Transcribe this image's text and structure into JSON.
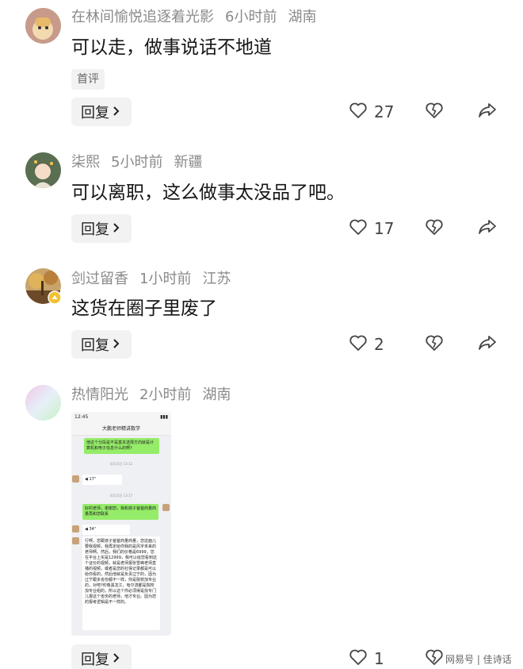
{
  "comments": [
    {
      "username": "在林间愉悦追逐着光影",
      "time": "6小时前",
      "location": "湖南",
      "text": "可以走，做事说话不地道",
      "tag": "首评",
      "reply_label": "回复",
      "likes": "27",
      "avatar_color": "#c79a8a"
    },
    {
      "username": "柒熙",
      "time": "5小时前",
      "location": "新疆",
      "text": "可以离职，这么做事太没品了吧。",
      "reply_label": "回复",
      "likes": "17",
      "avatar_color": "#5a6f52"
    },
    {
      "username": "剑过留香",
      "time": "1小时前",
      "location": "江苏",
      "text": "这货在圈子里废了",
      "reply_label": "回复",
      "likes": "2",
      "avatar_color": "#8a6a3a"
    },
    {
      "username": "热情阳光",
      "time": "2小时前",
      "location": "湖南",
      "reply_label": "回复",
      "likes": "1",
      "avatar_color": "#d9e6f5"
    }
  ],
  "attached_screenshot": {
    "status_time": "12:45",
    "chat_title": "大鹏老师精讲数学",
    "timestamp_1": "4月13日 13:12",
    "timestamp_2": "4月13日 13:17",
    "msg_1": "他这个分段是不是基本选择方向就是计算机和电子信息什么的啊?",
    "voice_1": "17\"",
    "msg_2": "好的老师，谢谢您，我和孩子爸爸商量商量再和您联系",
    "voice_2": "34\"",
    "msg_3": "行啊，您跟孩子爸爸商量商量，您这面儿要我视频，我再定给你我的是风字未来的老师啊。然后，我们的价格是6999，您在平台上买是12999，我可以给您看到这个证价的视频，就是老师报张雪峰老师直播的视频，或者是您的社保记录都是可以给你看的，然后他就是负责辽宁的，因为辽宁跟多省份都不一样，你是院校加专业的，对吧?你像黑龙江，哈尔滨都是院校加专业组的，所以这个你必须得是找专门儿报这个省份的老师，他才专业。因为您的报考逻辑是不一样的。"
  },
  "watermark": "网易号 | 佳诗话",
  "colors": {
    "meta": "#8a8a8a",
    "text": "#151515",
    "button_bg": "#f2f2f2",
    "chat_green": "#95ec69"
  },
  "icons": [
    "heart-outline-icon",
    "broken-heart-icon",
    "share-arrow-icon",
    "chevron-right-icon",
    "verified-badge-icon"
  ]
}
